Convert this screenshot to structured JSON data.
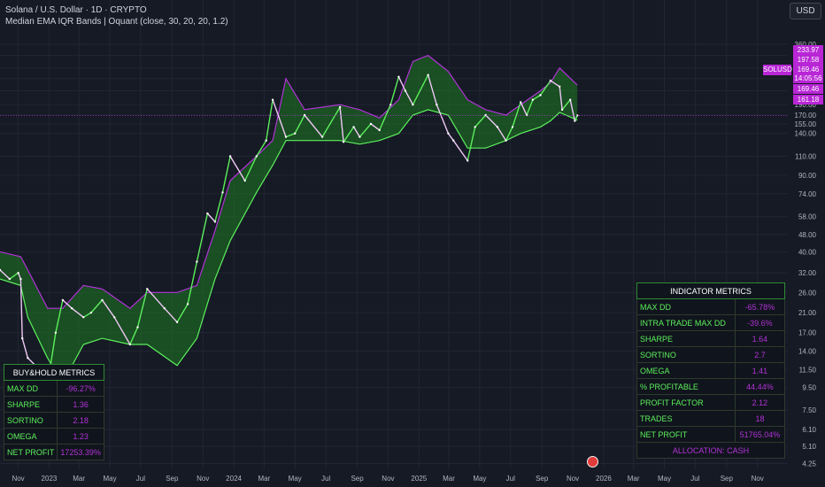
{
  "header": {
    "title": "Solana / U.S. Dollar · 1D · CRYPTO",
    "indicator": "Median EMA IQR Bands | Oquant (close, 30, 20, 20, 1.2)"
  },
  "currency_button": "USD",
  "price_tags": {
    "symbol": "SOLUSD",
    "upper_band": "233.97",
    "upper_mid": "197.58",
    "last_price": "169.46",
    "countdown": "14:05:56",
    "median": "169.46",
    "lower_band": "161.18"
  },
  "colors": {
    "background": "#161a25",
    "bull": "#5cf05c",
    "bear": "#b232d8",
    "bull_fill": "#1f7a23",
    "bear_fill": "#7a1fa0",
    "grid": "#222632",
    "axis_text": "#b2b5be"
  },
  "buy_hold_metrics": {
    "title": "BUY&HOLD METRICS",
    "rows": [
      {
        "label": "MAX DD",
        "value": "-96.27%"
      },
      {
        "label": "SHARPE",
        "value": "1.36"
      },
      {
        "label": "SORTINO",
        "value": "2.18"
      },
      {
        "label": "OMEGA",
        "value": "1.23"
      },
      {
        "label": "NET PROFIT",
        "value": "17253.39%"
      }
    ]
  },
  "indicator_metrics": {
    "title": "INDICATOR METRICS",
    "rows": [
      {
        "label": "MAX DD",
        "value": "-65.78%"
      },
      {
        "label": "INTRA TRADE MAX DD",
        "value": "-39.6%"
      },
      {
        "label": "SHARPE",
        "value": "1.64"
      },
      {
        "label": "SORTINO",
        "value": "2.7"
      },
      {
        "label": "OMEGA",
        "value": "1.41"
      },
      {
        "label": "% PROFITABLE",
        "value": "44.44%"
      },
      {
        "label": "PROFIT FACTOR",
        "value": "2.12"
      },
      {
        "label": "TRADES",
        "value": "18"
      },
      {
        "label": "NET PROFIT",
        "value": "51765.04%"
      }
    ],
    "footer": "ALLOCATION: CASH"
  },
  "chart_data": {
    "type": "line",
    "scale": "log",
    "grid": true,
    "y_ticks": [
      "360.00",
      "320.00",
      "280.00",
      "250.00",
      "220.00",
      "190.00",
      "170.00",
      "155.00",
      "140.00",
      "110.00",
      "90.00",
      "74.00",
      "58.00",
      "48.00",
      "40.00",
      "32.00",
      "26.00",
      "21.00",
      "17.00",
      "14.00",
      "11.50",
      "9.50",
      "7.50",
      "6.10",
      "5.10",
      "4.25"
    ],
    "x_ticks": [
      "Nov",
      "2023",
      "Mar",
      "May",
      "Jul",
      "Sep",
      "Nov",
      "2024",
      "Mar",
      "May",
      "Jul",
      "Sep",
      "Nov",
      "2025",
      "Mar",
      "May",
      "Jul",
      "Sep",
      "Nov",
      "2026",
      "Mar",
      "May",
      "Jul",
      "Sep",
      "Nov"
    ],
    "x_tick_dates": [
      "2022-11-01",
      "2023-01-01",
      "2023-03-01",
      "2023-05-01",
      "2023-07-01",
      "2023-09-01",
      "2023-11-01",
      "2024-01-01",
      "2024-03-01",
      "2024-05-01",
      "2024-07-01",
      "2024-09-01",
      "2024-11-01",
      "2025-01-01",
      "2025-03-01",
      "2025-05-01",
      "2025-07-01",
      "2025-09-01",
      "2025-11-01",
      "2026-01-01",
      "2026-03-01",
      "2026-05-01",
      "2026-07-01",
      "2026-09-01",
      "2026-11-01"
    ],
    "x_range": [
      "2022-09-26",
      "2026-12-31"
    ],
    "y_range": [
      4.0,
      360.0
    ],
    "series": [
      {
        "kind": "price",
        "x": [
          "2022-09-26",
          "2022-10-15",
          "2022-11-01",
          "2022-11-06",
          "2022-11-09",
          "2022-11-20",
          "2022-12-05",
          "2022-12-29",
          "2023-01-14",
          "2023-01-28",
          "2023-02-15",
          "2023-03-10",
          "2023-03-25",
          "2023-04-16",
          "2023-05-10",
          "2023-06-10",
          "2023-06-25",
          "2023-07-14",
          "2023-08-17",
          "2023-09-11",
          "2023-10-02",
          "2023-10-20",
          "2023-11-10",
          "2023-11-25",
          "2023-12-10",
          "2023-12-25",
          "2024-01-23",
          "2024-02-15",
          "2024-03-05",
          "2024-03-18",
          "2024-04-13",
          "2024-05-01",
          "2024-05-20",
          "2024-06-24",
          "2024-07-29",
          "2024-08-05",
          "2024-08-25",
          "2024-09-06",
          "2024-09-28",
          "2024-10-15",
          "2024-11-06",
          "2024-11-22",
          "2024-12-05",
          "2024-12-20",
          "2025-01-19",
          "2025-02-05",
          "2025-02-28",
          "2025-03-10",
          "2025-04-07",
          "2025-04-22",
          "2025-05-13",
          "2025-06-05",
          "2025-06-22",
          "2025-07-05",
          "2025-07-21",
          "2025-08-02",
          "2025-08-14",
          "2025-08-29",
          "2025-09-18",
          "2025-10-06",
          "2025-10-11",
          "2025-10-27",
          "2025-11-05",
          "2025-11-10"
        ],
        "y": [
          33,
          30,
          32,
          30,
          16,
          13,
          12,
          9.8,
          17,
          24,
          22,
          20,
          21,
          24,
          20,
          15,
          18,
          27,
          22,
          19,
          23,
          36,
          60,
          55,
          75,
          110,
          85,
          110,
          130,
          200,
          135,
          140,
          170,
          135,
          185,
          128,
          150,
          135,
          155,
          145,
          190,
          255,
          220,
          190,
          260,
          190,
          140,
          130,
          105,
          150,
          170,
          150,
          130,
          150,
          195,
          170,
          200,
          210,
          245,
          230,
          180,
          200,
          160,
          169.46
        ]
      },
      {
        "kind": "median_band_upper",
        "x": [
          "2022-09-26",
          "2022-11-06",
          "2022-11-20",
          "2022-12-29",
          "2023-01-28",
          "2023-03-10",
          "2023-04-16",
          "2023-06-10",
          "2023-07-14",
          "2023-09-11",
          "2023-10-20",
          "2023-11-25",
          "2023-12-25",
          "2024-02-15",
          "2024-03-18",
          "2024-04-13",
          "2024-05-20",
          "2024-07-29",
          "2024-09-06",
          "2024-10-15",
          "2024-11-22",
          "2024-12-20",
          "2025-01-19",
          "2025-02-28",
          "2025-04-07",
          "2025-05-13",
          "2025-06-22",
          "2025-07-21",
          "2025-08-29",
          "2025-09-18",
          "2025-10-06",
          "2025-11-10"
        ],
        "y": [
          40,
          38,
          33,
          22,
          22,
          28,
          27,
          22,
          26,
          26,
          28,
          50,
          85,
          110,
          130,
          250,
          180,
          190,
          180,
          165,
          200,
          300,
          320,
          270,
          200,
          180,
          170,
          190,
          220,
          240,
          280,
          233.97
        ]
      },
      {
        "kind": "median_band_lower",
        "x": [
          "2022-09-26",
          "2022-11-06",
          "2022-11-20",
          "2022-12-29",
          "2023-01-28",
          "2023-03-10",
          "2023-04-16",
          "2023-06-10",
          "2023-07-14",
          "2023-09-11",
          "2023-10-20",
          "2023-11-25",
          "2023-12-25",
          "2024-02-15",
          "2024-03-18",
          "2024-04-13",
          "2024-05-20",
          "2024-07-29",
          "2024-09-06",
          "2024-10-15",
          "2024-11-22",
          "2024-12-20",
          "2025-01-19",
          "2025-02-28",
          "2025-04-07",
          "2025-05-13",
          "2025-06-22",
          "2025-07-21",
          "2025-08-29",
          "2025-09-18",
          "2025-10-06",
          "2025-11-10"
        ],
        "y": [
          30,
          28,
          20,
          13,
          10,
          15,
          16,
          15,
          15,
          12,
          16,
          30,
          45,
          75,
          100,
          130,
          130,
          130,
          125,
          130,
          140,
          170,
          180,
          170,
          120,
          120,
          130,
          140,
          150,
          160,
          175,
          161.18
        ]
      }
    ]
  }
}
